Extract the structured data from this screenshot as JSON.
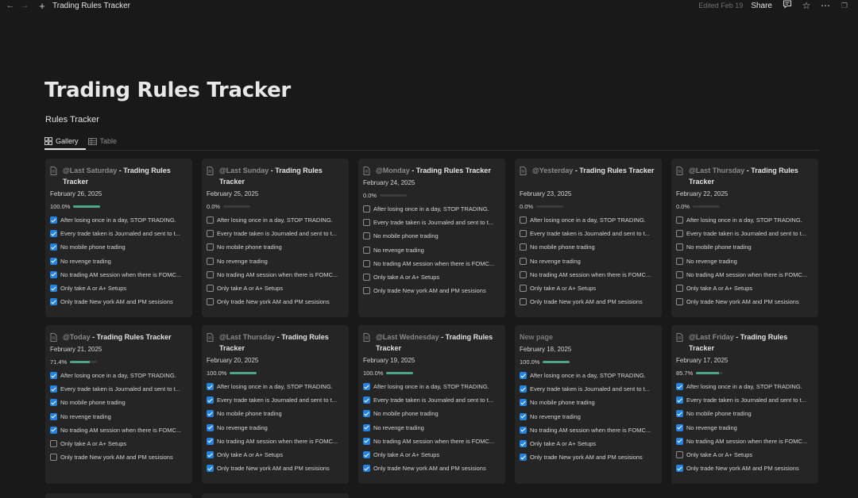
{
  "tab": {
    "title": "Trading Rules Tracker"
  },
  "top_right": {
    "edited": "Edited Feb 19",
    "share": "Share"
  },
  "icons": {
    "back": "arrow-left-icon",
    "forward": "arrow-right-icon",
    "new_tab": "plus-icon",
    "comment": "comment-icon",
    "favorite": "star-icon",
    "more": "more-icon",
    "restore": "window-restore-icon",
    "doc": "page-icon",
    "gallery": "gallery-icon",
    "table": "table-icon"
  },
  "page": {
    "title": "Trading Rules Tracker"
  },
  "database": {
    "title": "Rules Tracker",
    "views": [
      {
        "label": "Gallery",
        "active": true
      },
      {
        "label": "Table",
        "active": false
      }
    ]
  },
  "colors": {
    "background": "#191919",
    "card": "#252525",
    "progress": "#4da585",
    "checkbox": "#2383e2"
  },
  "cards": [
    {
      "mention": "@Last Saturday",
      "suffix": " - Trading Rules Tracker",
      "date": "February 26, 2025",
      "progress_label": "100.0%",
      "progress": 1.0,
      "rules": [
        {
          "text": "After losing once in a day, STOP TRADING.",
          "checked": true
        },
        {
          "text": "Every trade taken is Journaled and sent to t...",
          "checked": true
        },
        {
          "text": "No mobile phone trading",
          "checked": true
        },
        {
          "text": "No revenge trading",
          "checked": true
        },
        {
          "text": "No trading AM session when there is FOMC...",
          "checked": true
        },
        {
          "text": "Only take A or A+ Setups",
          "checked": true
        },
        {
          "text": "Only trade New york AM and PM sesisions",
          "checked": true
        }
      ]
    },
    {
      "mention": "@Last Sunday",
      "suffix": " - Trading Rules Tracker",
      "date": "February 25, 2025",
      "progress_label": "0.0%",
      "progress": 0.0,
      "rules": [
        {
          "text": "After losing once in a day, STOP TRADING.",
          "checked": false
        },
        {
          "text": "Every trade taken is Journaled and sent to t...",
          "checked": false
        },
        {
          "text": "No mobile phone trading",
          "checked": false
        },
        {
          "text": "No revenge trading",
          "checked": false
        },
        {
          "text": "No trading AM session when there is FOMC...",
          "checked": false
        },
        {
          "text": "Only take A or A+ Setups",
          "checked": false
        },
        {
          "text": "Only trade New york AM and PM sesisions",
          "checked": false
        }
      ]
    },
    {
      "mention": "@Monday",
      "suffix": " - Trading Rules Tracker",
      "date": "February 24, 2025",
      "progress_label": "0.0%",
      "progress": 0.0,
      "rules": [
        {
          "text": "After losing once in a day, STOP TRADING.",
          "checked": false
        },
        {
          "text": "Every trade taken is Journaled and sent to t...",
          "checked": false
        },
        {
          "text": "No mobile phone trading",
          "checked": false
        },
        {
          "text": "No revenge trading",
          "checked": false
        },
        {
          "text": "No trading AM session when there is FOMC...",
          "checked": false
        },
        {
          "text": "Only take A or A+ Setups",
          "checked": false
        },
        {
          "text": "Only trade New york AM and PM sesisions",
          "checked": false
        }
      ]
    },
    {
      "mention": "@Yesterday",
      "suffix": " - Trading Rules Tracker",
      "date": "February 23, 2025",
      "progress_label": "0.0%",
      "progress": 0.0,
      "rules": [
        {
          "text": "After losing once in a day, STOP TRADING.",
          "checked": false
        },
        {
          "text": "Every trade taken is Journaled and sent to t...",
          "checked": false
        },
        {
          "text": "No mobile phone trading",
          "checked": false
        },
        {
          "text": "No revenge trading",
          "checked": false
        },
        {
          "text": "No trading AM session when there is FOMC...",
          "checked": false
        },
        {
          "text": "Only take A or A+ Setups",
          "checked": false
        },
        {
          "text": "Only trade New york AM and PM sesisions",
          "checked": false
        }
      ]
    },
    {
      "mention": "@Last Thursday",
      "suffix": " - Trading Rules Tracker",
      "date": "February 22, 2025",
      "progress_label": "0.0%",
      "progress": 0.0,
      "rules": [
        {
          "text": "After losing once in a day, STOP TRADING.",
          "checked": false
        },
        {
          "text": "Every trade taken is Journaled and sent to t...",
          "checked": false
        },
        {
          "text": "No mobile phone trading",
          "checked": false
        },
        {
          "text": "No revenge trading",
          "checked": false
        },
        {
          "text": "No trading AM session when there is FOMC...",
          "checked": false
        },
        {
          "text": "Only take A or A+ Setups",
          "checked": false
        },
        {
          "text": "Only trade New york AM and PM sesisions",
          "checked": false
        }
      ]
    },
    {
      "mention": "@Today",
      "suffix": " - Trading Rules Tracker",
      "date": "February 21, 2025",
      "progress_label": "71.4%",
      "progress": 0.714,
      "rules": [
        {
          "text": "After losing once in a day, STOP TRADING.",
          "checked": true
        },
        {
          "text": "Every trade taken is Journaled and sent to t...",
          "checked": true
        },
        {
          "text": "No mobile phone trading",
          "checked": true
        },
        {
          "text": "No revenge trading",
          "checked": true
        },
        {
          "text": "No trading AM session when there is FOMC...",
          "checked": true
        },
        {
          "text": "Only take A or A+ Setups",
          "checked": false
        },
        {
          "text": "Only trade New york AM and PM sesisions",
          "checked": false
        }
      ]
    },
    {
      "mention": "@Last Thursday",
      "suffix": " - Trading Rules Tracker",
      "date": "February 20, 2025",
      "progress_label": "100.0%",
      "progress": 1.0,
      "rules": [
        {
          "text": "After losing once in a day, STOP TRADING.",
          "checked": true
        },
        {
          "text": "Every trade taken is Journaled and sent to t...",
          "checked": true
        },
        {
          "text": "No mobile phone trading",
          "checked": true
        },
        {
          "text": "No revenge trading",
          "checked": true
        },
        {
          "text": "No trading AM session when there is FOMC...",
          "checked": true
        },
        {
          "text": "Only take A or A+ Setups",
          "checked": true
        },
        {
          "text": "Only trade New york AM and PM sesisions",
          "checked": true
        }
      ]
    },
    {
      "mention": "@Last Wednesday",
      "suffix": " - Trading Rules Tracker",
      "date": "February 19, 2025",
      "progress_label": "100.0%",
      "progress": 1.0,
      "rules": [
        {
          "text": "After losing once in a day, STOP TRADING.",
          "checked": true
        },
        {
          "text": "Every trade taken is Journaled and sent to t...",
          "checked": true
        },
        {
          "text": "No mobile phone trading",
          "checked": true
        },
        {
          "text": "No revenge trading",
          "checked": true
        },
        {
          "text": "No trading AM session when there is FOMC...",
          "checked": true
        },
        {
          "text": "Only take A or A+ Setups",
          "checked": true
        },
        {
          "text": "Only trade New york AM and PM sesisions",
          "checked": true
        }
      ]
    },
    {
      "mention": "",
      "suffix": "",
      "new_page": "New page",
      "date": "February 18, 2025",
      "progress_label": "100.0%",
      "progress": 1.0,
      "rules": [
        {
          "text": "After losing once in a day, STOP TRADING.",
          "checked": true
        },
        {
          "text": "Every trade taken is Journaled and sent to t...",
          "checked": true
        },
        {
          "text": "No mobile phone trading",
          "checked": true
        },
        {
          "text": "No revenge trading",
          "checked": true
        },
        {
          "text": "No trading AM session when there is FOMC...",
          "checked": true
        },
        {
          "text": "Only take A or A+ Setups",
          "checked": true
        },
        {
          "text": "Only trade New york AM and PM sesisions",
          "checked": true
        }
      ]
    },
    {
      "mention": "@Last Friday",
      "suffix": " - Trading Rules Tracker",
      "date": "February 17, 2025",
      "progress_label": "85.7%",
      "progress": 0.857,
      "rules": [
        {
          "text": "After losing once in a day, STOP TRADING.",
          "checked": true
        },
        {
          "text": "Every trade taken is Journaled and sent to t...",
          "checked": true
        },
        {
          "text": "No mobile phone trading",
          "checked": true
        },
        {
          "text": "No revenge trading",
          "checked": true
        },
        {
          "text": "No trading AM session when there is FOMC...",
          "checked": true
        },
        {
          "text": "Only take A or A+ Setups",
          "checked": false
        },
        {
          "text": "Only trade New york AM and PM sesisions",
          "checked": true
        }
      ]
    }
  ]
}
